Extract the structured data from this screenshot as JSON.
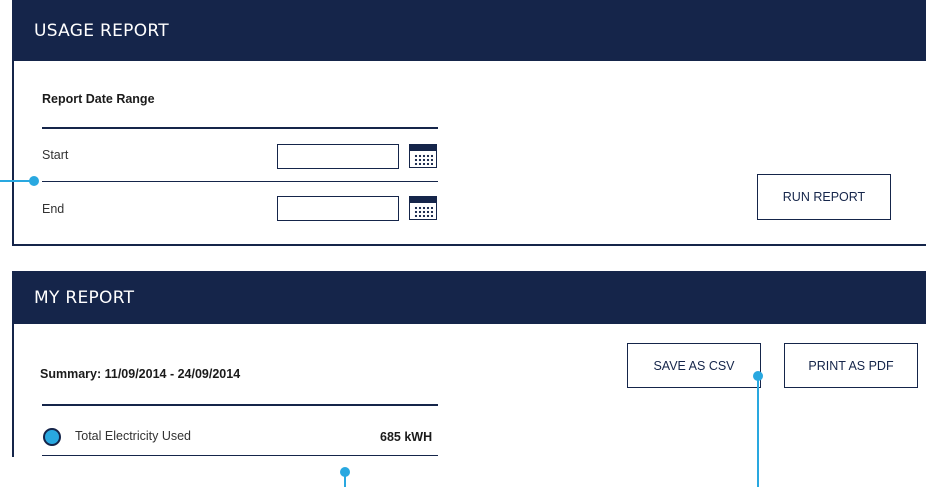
{
  "usage_report": {
    "title": "USAGE REPORT",
    "date_range_label": "Report Date Range",
    "start_label": "Start",
    "end_label": "End",
    "start_value": "",
    "end_value": "",
    "run_button": "RUN REPORT"
  },
  "my_report": {
    "title": "MY REPORT",
    "summary": "Summary: 11/09/2014 - 24/09/2014",
    "save_csv_button": "SAVE AS CSV",
    "print_pdf_button": "PRINT AS PDF",
    "total_label": "Total Electricity Used",
    "total_value": "685 kWH"
  },
  "icons": {
    "calendar": "calendar-icon",
    "legend_dot": "circle-icon"
  },
  "colors": {
    "navy": "#15254a",
    "accent": "#29a8e0"
  }
}
